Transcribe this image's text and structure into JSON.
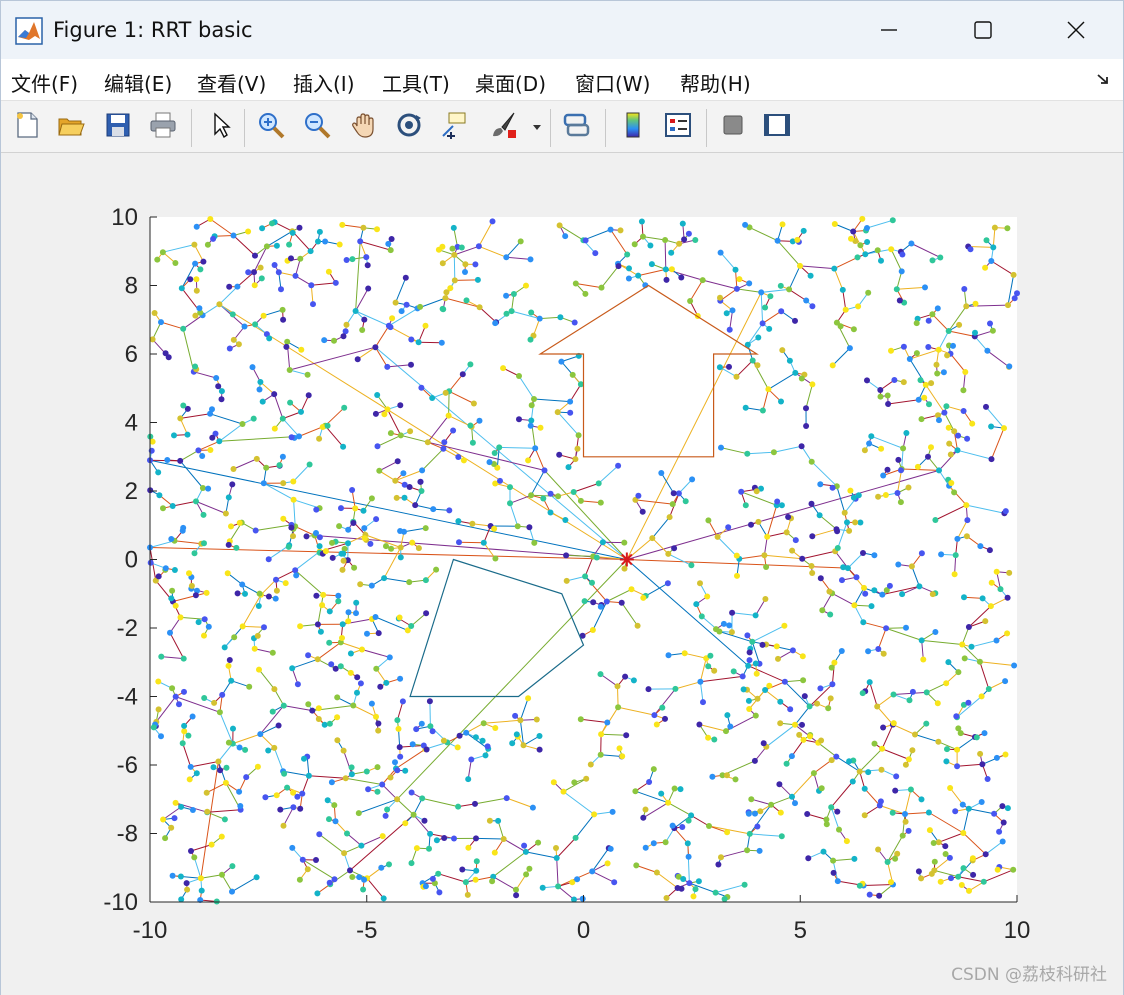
{
  "window": {
    "title": "Figure 1: RRT basic",
    "controls": {
      "minimize": "minimize",
      "maximize": "maximize",
      "close": "close"
    }
  },
  "menu": {
    "items": [
      {
        "label": "文件(F)"
      },
      {
        "label": "编辑(E)"
      },
      {
        "label": "查看(V)"
      },
      {
        "label": "插入(I)"
      },
      {
        "label": "工具(T)"
      },
      {
        "label": "桌面(D)"
      },
      {
        "label": "窗口(W)"
      },
      {
        "label": "帮助(H)"
      }
    ]
  },
  "toolbar": {
    "buttons": [
      "new-figure-icon",
      "open-file-icon",
      "save-icon",
      "print-icon",
      "edit-pointer-icon",
      "zoom-in-icon",
      "zoom-out-icon",
      "pan-icon",
      "rotate-3d-icon",
      "data-cursor-icon",
      "brush-icon",
      "brush-dropdown-icon",
      "link-plot-icon",
      "colorbar-icon",
      "legend-icon",
      "hide-plot-tools-icon",
      "show-plot-tools-icon"
    ]
  },
  "colors": {
    "axes_background": "#ffffff",
    "figure_background": "#f0f0f0",
    "obstacle_arrow": "#c85a1a",
    "obstacle_hexagon": "#1a6b8a",
    "start_marker": "#d7191c",
    "edge_palette": [
      "#0072bd",
      "#d95319",
      "#edb120",
      "#7e2f8e",
      "#77ac30",
      "#4dbeee",
      "#a2142f"
    ],
    "node_palette": [
      "#3e26a8",
      "#4755f0",
      "#2b90f5",
      "#13b3c8",
      "#2fc79a",
      "#8cc63e",
      "#d4c230",
      "#f9e519"
    ]
  },
  "chart_data": {
    "type": "scatter",
    "title": "",
    "xlabel": "",
    "ylabel": "",
    "xlim": [
      -10,
      10
    ],
    "ylim": [
      -10,
      10
    ],
    "xticks": [
      "-10",
      "-5",
      "0",
      "5",
      "10"
    ],
    "yticks": [
      "-10",
      "-8",
      "-6",
      "-4",
      "-2",
      "0",
      "2",
      "4",
      "6",
      "8",
      "10"
    ],
    "grid": false,
    "legend": "none",
    "start": {
      "x": 1,
      "y": 0
    },
    "obstacles": [
      {
        "name": "arrow",
        "points": [
          [
            0,
            3
          ],
          [
            3,
            3
          ],
          [
            3,
            6
          ],
          [
            4,
            6
          ],
          [
            1.5,
            8
          ],
          [
            -1,
            6
          ],
          [
            0,
            6
          ]
        ]
      },
      {
        "name": "hexagon",
        "points": [
          [
            -3,
            0
          ],
          [
            -0.5,
            -1
          ],
          [
            0,
            -2.5
          ],
          [
            -1.5,
            -4
          ],
          [
            -4,
            -4
          ],
          [
            -3.5,
            -2
          ]
        ]
      }
    ],
    "tree": {
      "node_count": 1400,
      "hubs": [
        {
          "x": -10,
          "y": 2.9
        },
        {
          "x": -10,
          "y": 0.35
        },
        {
          "x": -8.4,
          "y": 7.45
        },
        {
          "x": -6.2,
          "y": 0.7
        },
        {
          "x": -4.3,
          "y": -7.0
        },
        {
          "x": -4.8,
          "y": 6.2
        },
        {
          "x": 1.0,
          "y": 0.0
        },
        {
          "x": 3.8,
          "y": -3.1
        },
        {
          "x": 6.1,
          "y": -0.25
        },
        {
          "x": 4.1,
          "y": 7.8
        },
        {
          "x": 8.2,
          "y": 2.6
        },
        {
          "x": -0.9,
          "y": 2.6
        }
      ]
    }
  },
  "watermark": "CSDN @荔枝科研社"
}
